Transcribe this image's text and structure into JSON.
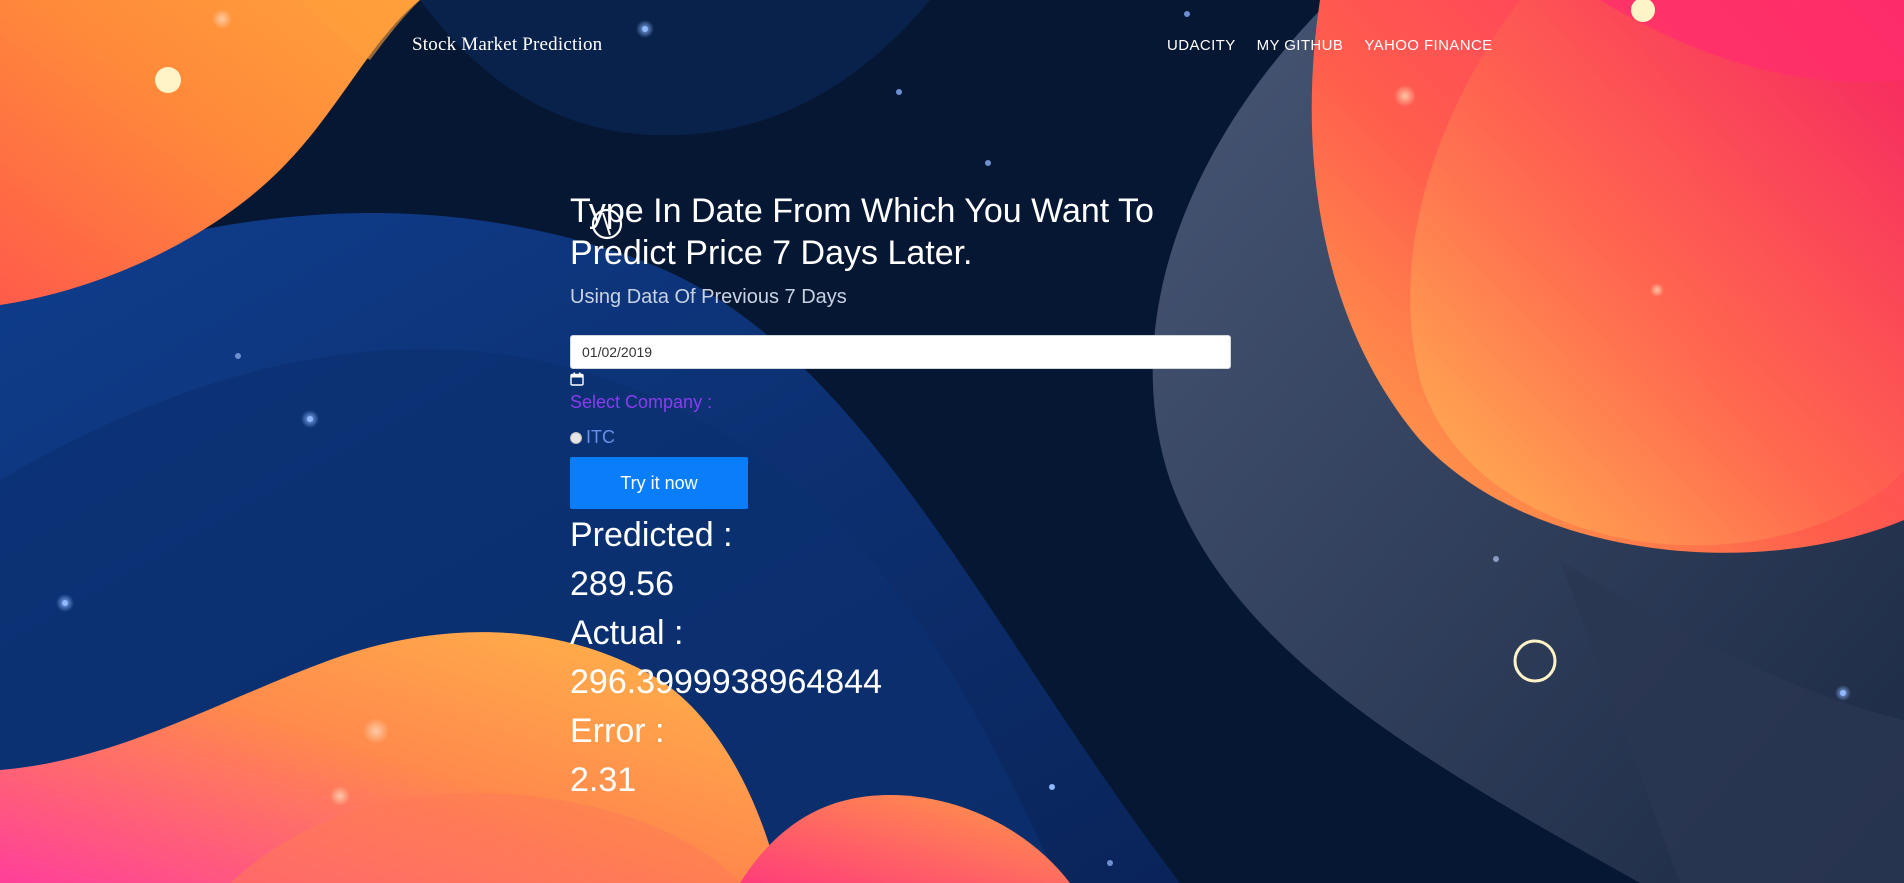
{
  "navbar": {
    "brand": "Stock Market Prediction",
    "links": [
      "UDACITY",
      "MY GITHUB",
      "YAHOO FINANCE"
    ]
  },
  "form": {
    "headline_line1": "Type In Date From Which You Want To",
    "headline_line2": "Predict Price 7 Days Later.",
    "subheading": "Using Data Of Previous 7 Days",
    "date_value": "01/02/2019",
    "calendar_icon": "calendar-icon",
    "company_label": "Select Company :",
    "company_option": "ITC",
    "submit_label": "Try it now"
  },
  "results": {
    "predicted_label": "Predicted :",
    "predicted_value": "289.56",
    "actual_label": "Actual :",
    "actual_value": "296.3999938964844",
    "error_label": "Error :",
    "error_value": "2.31"
  },
  "colors": {
    "background": "#071a3b",
    "accent_button": "#0a7dfb",
    "label_purple": "#8a3cf0",
    "option_blue": "#6a8fe6"
  }
}
